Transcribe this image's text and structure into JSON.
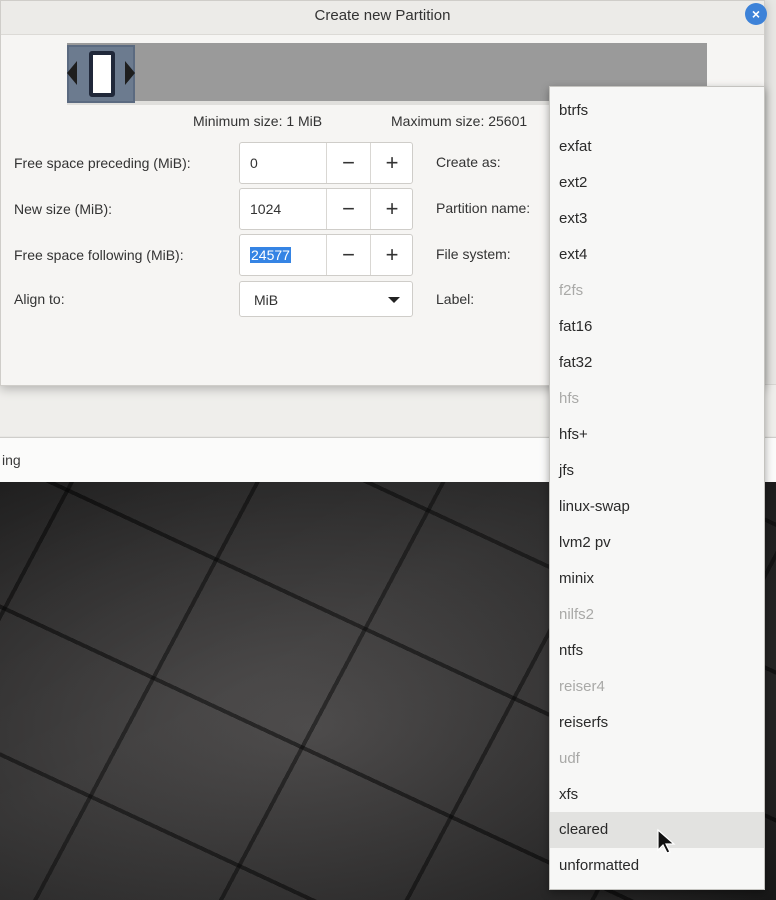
{
  "dialog": {
    "title": "Create new Partition",
    "close_label": "×",
    "min_size": "Minimum size: 1 MiB",
    "max_size": "Maximum size: 25601",
    "fields": {
      "preceding": {
        "label": "Free space preceding (MiB):",
        "value": "0"
      },
      "new_size": {
        "label": "New size (MiB):",
        "value": "1024"
      },
      "following": {
        "label": "Free space following (MiB):",
        "value": "24577"
      },
      "align": {
        "label": "Align to:",
        "value": "MiB"
      }
    },
    "spin_minus": "−",
    "spin_plus": "+",
    "right_labels": {
      "create_as": "Create as:",
      "partition_name": "Partition name:",
      "file_system": "File system:",
      "label": "Label:"
    }
  },
  "background_window": {
    "partial_text": "ing"
  },
  "filesystem_menu": {
    "items": [
      {
        "label": "btrfs",
        "enabled": true
      },
      {
        "label": "exfat",
        "enabled": true
      },
      {
        "label": "ext2",
        "enabled": true
      },
      {
        "label": "ext3",
        "enabled": true
      },
      {
        "label": "ext4",
        "enabled": true
      },
      {
        "label": "f2fs",
        "enabled": false
      },
      {
        "label": "fat16",
        "enabled": true
      },
      {
        "label": "fat32",
        "enabled": true
      },
      {
        "label": "hfs",
        "enabled": false
      },
      {
        "label": "hfs+",
        "enabled": true
      },
      {
        "label": "jfs",
        "enabled": true
      },
      {
        "label": "linux-swap",
        "enabled": true
      },
      {
        "label": "lvm2 pv",
        "enabled": true
      },
      {
        "label": "minix",
        "enabled": true
      },
      {
        "label": "nilfs2",
        "enabled": false
      },
      {
        "label": "ntfs",
        "enabled": true
      },
      {
        "label": "reiser4",
        "enabled": false
      },
      {
        "label": "reiserfs",
        "enabled": true
      },
      {
        "label": "udf",
        "enabled": false
      },
      {
        "label": "xfs",
        "enabled": true
      },
      {
        "label": "cleared",
        "enabled": true,
        "hovered": true
      },
      {
        "label": "unformatted",
        "enabled": true
      }
    ]
  }
}
